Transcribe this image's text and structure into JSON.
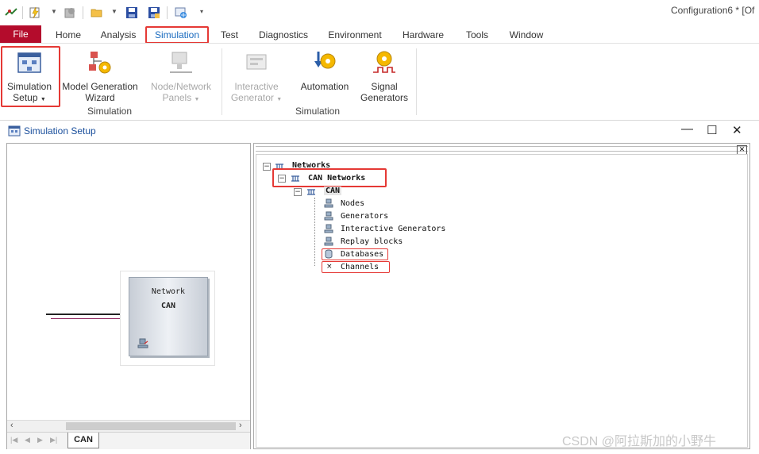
{
  "window_title": "Configuration6 * [Of",
  "tabs": {
    "file": "File",
    "items": [
      "Home",
      "Analysis",
      "Simulation",
      "Test",
      "Diagnostics",
      "Environment",
      "Hardware",
      "Tools",
      "Window"
    ],
    "active": "Simulation"
  },
  "ribbon": {
    "simulation_setup": {
      "line1": "Simulation",
      "line2": "Setup"
    },
    "model_wizard": {
      "line1": "Model Generation",
      "line2": "Wizard"
    },
    "node_panels": {
      "line1": "Node/Network",
      "line2": "Panels"
    },
    "interactive_gen": {
      "line1": "Interactive",
      "line2": "Generator"
    },
    "automation": {
      "line1": "Automation"
    },
    "signal_gen": {
      "line1": "Signal",
      "line2": "Generators"
    },
    "group1_label": "Simulation",
    "group2_label": "Simulation"
  },
  "setup_window": {
    "title": "Simulation Setup",
    "network_box": {
      "line1": "Network",
      "line2": "CAN"
    },
    "bottom_tab": "CAN"
  },
  "tree": {
    "root": "Networks",
    "can_networks": "CAN Networks",
    "can": "CAN",
    "children": [
      "Nodes",
      "Generators",
      "Interactive Generators",
      "Replay blocks",
      "Databases",
      "Channels"
    ]
  },
  "watermark": "CSDN @阿拉斯加的小野牛",
  "colors": {
    "file_tab": "#b40c2c",
    "highlight": "#e53935",
    "title_blue": "#1a4f9c"
  }
}
